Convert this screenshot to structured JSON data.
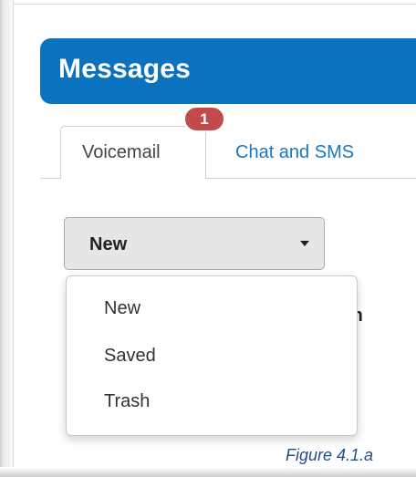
{
  "header": {
    "title": "Messages"
  },
  "tabs": [
    {
      "label": "Voicemail",
      "badge": "1",
      "active": true
    },
    {
      "label": "Chat and SMS",
      "active": false
    }
  ],
  "filter": {
    "selected": "New",
    "options": [
      "New",
      "Saved",
      "Trash"
    ],
    "partially_hidden_text": "m"
  },
  "caption": "Figure 4.1.a",
  "colors": {
    "header_bg": "#0a72bf",
    "badge_bg": "#c24a4a",
    "link": "#1a78c2",
    "caption": "#1f4e89"
  },
  "icons": {
    "select_caret": "caret-down-icon"
  }
}
